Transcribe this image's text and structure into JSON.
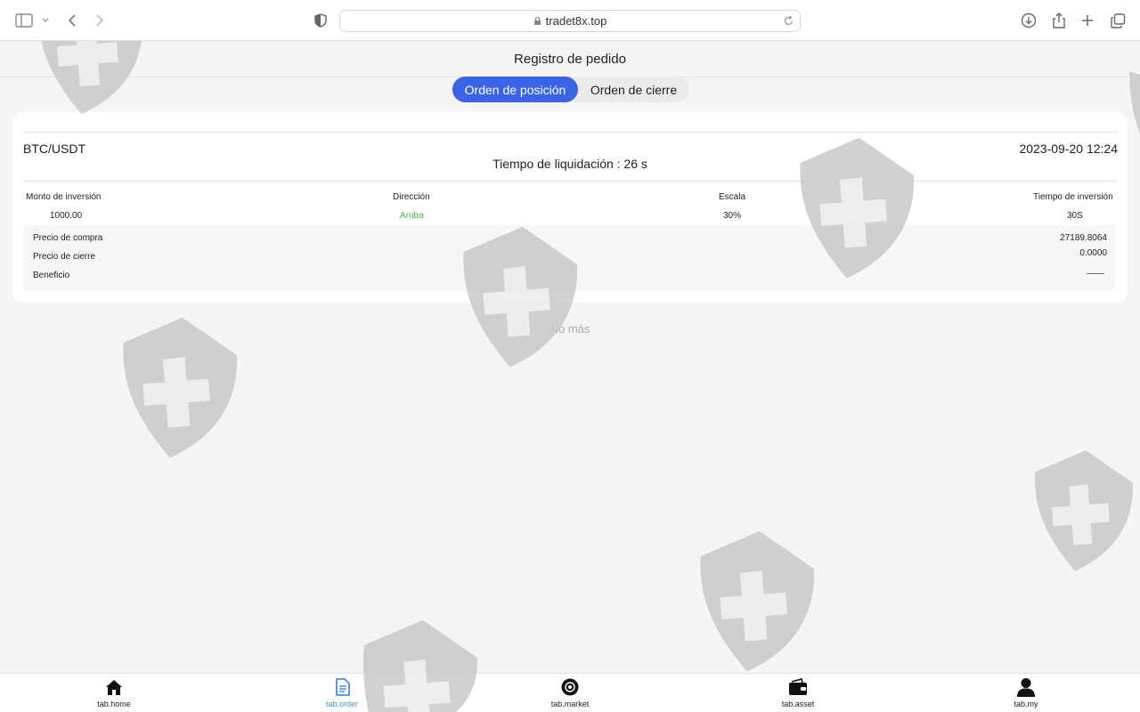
{
  "browser": {
    "url": "tradet8x.top"
  },
  "header": {
    "title": "Registro de pedido"
  },
  "segments": [
    {
      "label": "Orden de posición",
      "active": true
    },
    {
      "label": "Orden de cierre",
      "active": false
    }
  ],
  "order": {
    "pair": "BTC/USDT",
    "datetime": "2023-09-20 12:24",
    "liquidation": "Tiempo de liquidación : 26 s",
    "columns": [
      {
        "label": "Monto de inversión",
        "value": "1000.00"
      },
      {
        "label": "Dirección",
        "value": "Arriba"
      },
      {
        "label": "Escala",
        "value": "30%"
      },
      {
        "label": "Tiempo de inversión",
        "value": "30S"
      }
    ],
    "details": [
      {
        "label": "Precio de compra",
        "value": "27189.8064"
      },
      {
        "label": "Precio de cierre",
        "value": "0.0000"
      },
      {
        "label": "Beneficio",
        "value": "——"
      }
    ]
  },
  "list_end": "No más",
  "tabbar": [
    {
      "label": "tab.home",
      "icon": "home-icon",
      "active": false
    },
    {
      "label": "tab.order",
      "icon": "document-icon",
      "active": true
    },
    {
      "label": "tab.market",
      "icon": "market-icon",
      "active": false
    },
    {
      "label": "tab.asset",
      "icon": "wallet-icon",
      "active": false
    },
    {
      "label": "tab.my",
      "icon": "user-icon",
      "active": false
    }
  ],
  "colors": {
    "accent": "#3b63e5",
    "up_green": "#4caf50",
    "active_tab": "#4a90d9"
  }
}
